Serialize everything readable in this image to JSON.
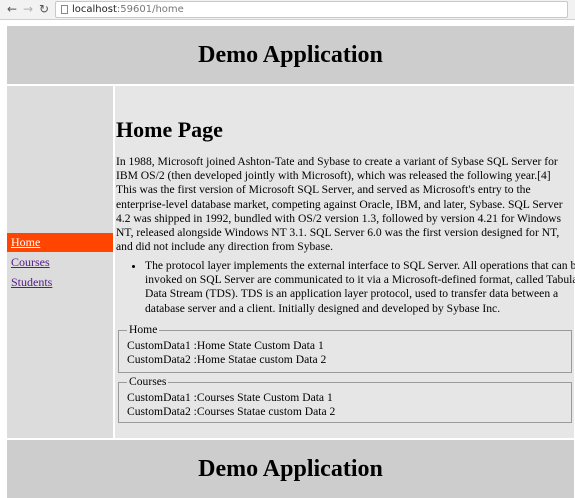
{
  "browser": {
    "url_host": "localhost",
    "url_rest": ":59601/home"
  },
  "header": {
    "title": "Demo Application"
  },
  "sidebar": {
    "items": [
      {
        "label": "Home",
        "active": true
      },
      {
        "label": "Courses",
        "active": false
      },
      {
        "label": "Students",
        "active": false
      }
    ]
  },
  "main": {
    "heading": "Home Page",
    "paragraph": "In 1988, Microsoft joined Ashton-Tate and Sybase to create a variant of Sybase SQL Server for IBM OS/2 (then developed jointly with Microsoft), which was released the following year.[4] This was the first version of Microsoft SQL Server, and served as Microsoft's entry to the enterprise-level database market, competing against Oracle, IBM, and later, Sybase. SQL Server 4.2 was shipped in 1992, bundled with OS/2 version 1.3, followed by version 4.21 for Windows NT, released alongside Windows NT 3.1. SQL Server 6.0 was the first version designed for NT, and did not include any direction from Sybase.",
    "bullets": [
      "The protocol layer implements the external interface to SQL Server. All operations that can be invoked on SQL Server are communicated to it via a Microsoft-defined format, called Tabular Data Stream (TDS). TDS is an application layer protocol, used to transfer data between a database server and a client. Initially designed and developed by Sybase Inc."
    ],
    "home_box": {
      "legend": "Home",
      "lines": [
        "CustomData1 :Home State Custom Data 1",
        "CustomData2 :Home Statae custom Data 2"
      ]
    },
    "courses_box": {
      "legend": "Courses",
      "lines": [
        "CustomData1 :Courses State Custom Data 1",
        "CustomData2 :Courses Statae custom Data 2"
      ]
    }
  },
  "footer": {
    "title": "Demo Application"
  },
  "colors": {
    "header_bg": "#cdcdcd",
    "sidebar_bg": "#dcdcdc",
    "main_bg": "#e6e6e6",
    "active_nav": "#ff4500"
  }
}
